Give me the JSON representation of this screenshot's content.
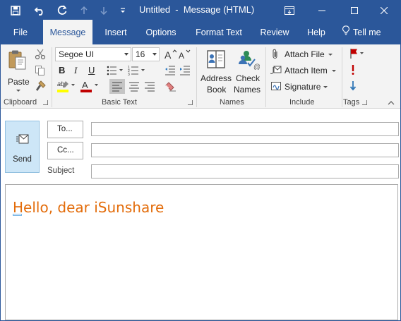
{
  "window": {
    "title": "Untitled  -  Message (HTML)"
  },
  "quick_access": {
    "icons": [
      "save-icon",
      "undo-icon",
      "redo-icon",
      "up-arrow-icon",
      "down-arrow-icon",
      "customize-icon"
    ]
  },
  "window_controls": [
    "ribbon-display-icon",
    "minimize-icon",
    "maximize-icon",
    "close-icon"
  ],
  "tabs": [
    {
      "label": "File"
    },
    {
      "label": "Message",
      "active": true
    },
    {
      "label": "Insert"
    },
    {
      "label": "Options"
    },
    {
      "label": "Format Text"
    },
    {
      "label": "Review"
    },
    {
      "label": "Help"
    },
    {
      "label": "Tell me"
    }
  ],
  "ribbon": {
    "clipboard": {
      "label": "Clipboard",
      "paste": "Paste"
    },
    "basic_text": {
      "label": "Basic Text",
      "font_name": "Segoe UI",
      "font_size": "16",
      "bold": "B",
      "italic": "I",
      "underline": "U"
    },
    "names": {
      "label": "Names",
      "address_book_line1": "Address",
      "address_book_line2": "Book",
      "check_names_line1": "Check",
      "check_names_line2": "Names"
    },
    "include": {
      "label": "Include",
      "attach_file": "Attach File",
      "attach_item": "Attach Item",
      "signature": "Signature"
    },
    "tags": {
      "label": "Tags"
    }
  },
  "compose": {
    "send": "Send",
    "to": "To...",
    "cc": "Cc...",
    "subject": "Subject",
    "to_value": "",
    "cc_value": "",
    "subject_value": "",
    "body": "Hello, dear iSunshare"
  },
  "colors": {
    "accent": "#2b579a",
    "ribbon_bg": "#f3f3f3",
    "body_text": "#e36c0a",
    "send_bg": "#cde6f7",
    "highlight_yellow": "#ffff00",
    "font_red": "#c00000",
    "flag_red": "#c00000",
    "low_importance_blue": "#2e75b6"
  }
}
